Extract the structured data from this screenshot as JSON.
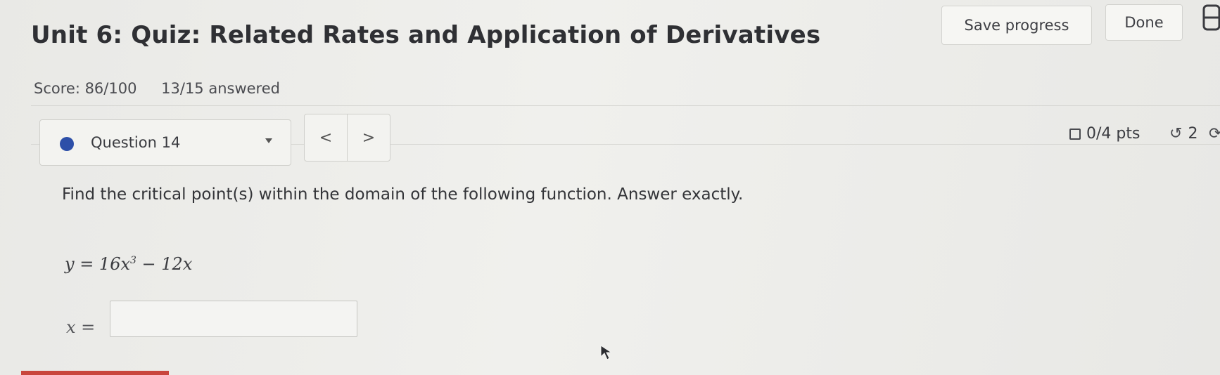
{
  "header": {
    "title": "Unit 6: Quiz: Related Rates and Application of Derivatives",
    "score": "Score: 86/100",
    "answered": "13/15 answered",
    "save_label": "Save progress",
    "done_label": "Done",
    "book_icon": "book-icon"
  },
  "question_nav": {
    "selected": "Question 14",
    "prev_symbol": "<",
    "next_symbol": ">",
    "points": "0/4 pts",
    "retry_count": "2",
    "dot_color": "#2d4fa8"
  },
  "question": {
    "prompt": "Find the critical point(s) within the domain of the following function. Answer exactly.",
    "equation_main": "y = 16x",
    "equation_exponent": "3",
    "equation_tail": " − 12x",
    "answer_label": "x =",
    "answer_value": ""
  }
}
